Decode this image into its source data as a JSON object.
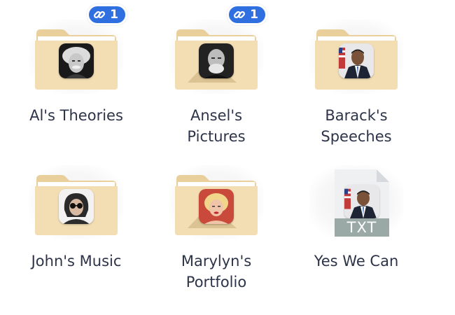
{
  "colors": {
    "folder_body": "#f3ddb3",
    "folder_tab": "#e9cf9c",
    "badge": "#2f6fe0",
    "label_text": "#2d3448",
    "doc_label_bg": "#9aa8a6"
  },
  "items": [
    {
      "type": "folder",
      "name": "Al's Theories",
      "thumb": "einstein-portrait",
      "badge": {
        "icon": "link-icon",
        "count": "1"
      }
    },
    {
      "type": "folder",
      "name": "Ansel's\nPictures",
      "thumb": "ansel-portrait",
      "badge": {
        "icon": "link-icon",
        "count": "1"
      }
    },
    {
      "type": "folder",
      "name": "Barack's\nSpeeches",
      "thumb": "obama-portrait"
    },
    {
      "type": "folder",
      "name": "John's Music",
      "thumb": "lennon-portrait"
    },
    {
      "type": "folder",
      "name": "Marylyn's\nPortfolio",
      "thumb": "monroe-portrait"
    },
    {
      "type": "file",
      "name": "Yes We Can",
      "thumb": "obama-portrait",
      "file_ext": "TXT"
    }
  ]
}
